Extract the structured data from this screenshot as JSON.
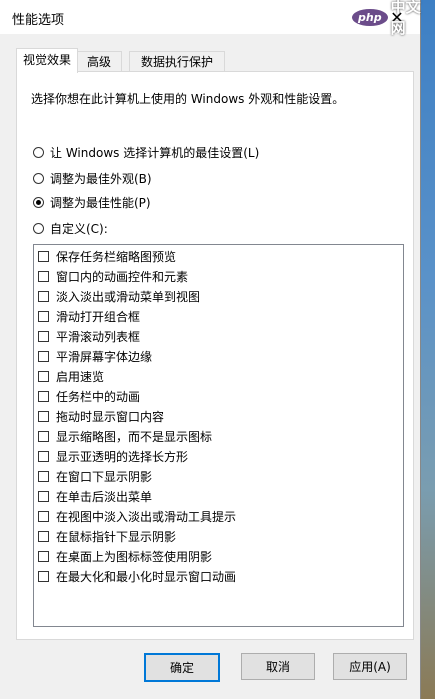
{
  "window": {
    "title": "性能选项",
    "close_glyph": "✕"
  },
  "watermark": {
    "logo": "php",
    "text": "中文网"
  },
  "tabs": [
    {
      "label": "视觉效果",
      "active": true
    },
    {
      "label": "高级",
      "active": false
    },
    {
      "label": "数据执行保护",
      "active": false
    }
  ],
  "description": "选择你想在此计算机上使用的 Windows 外观和性能设置。",
  "radio_options": [
    {
      "label": "让 Windows 选择计算机的最佳设置(L)",
      "selected": false
    },
    {
      "label": "调整为最佳外观(B)",
      "selected": false
    },
    {
      "label": "调整为最佳性能(P)",
      "selected": true
    },
    {
      "label": "自定义(C):",
      "selected": false
    }
  ],
  "checkbox_items": [
    {
      "label": "保存任务栏缩略图预览",
      "checked": false
    },
    {
      "label": "窗口内的动画控件和元素",
      "checked": false
    },
    {
      "label": "淡入淡出或滑动菜单到视图",
      "checked": false
    },
    {
      "label": "滑动打开组合框",
      "checked": false
    },
    {
      "label": "平滑滚动列表框",
      "checked": false
    },
    {
      "label": "平滑屏幕字体边缘",
      "checked": false
    },
    {
      "label": "启用速览",
      "checked": false
    },
    {
      "label": "任务栏中的动画",
      "checked": false
    },
    {
      "label": "拖动时显示窗口内容",
      "checked": false
    },
    {
      "label": "显示缩略图，而不是显示图标",
      "checked": false
    },
    {
      "label": "显示亚透明的选择长方形",
      "checked": false
    },
    {
      "label": "在窗口下显示阴影",
      "checked": false
    },
    {
      "label": "在单击后淡出菜单",
      "checked": false
    },
    {
      "label": "在视图中淡入淡出或滑动工具提示",
      "checked": false
    },
    {
      "label": "在鼠标指针下显示阴影",
      "checked": false
    },
    {
      "label": "在桌面上为图标标签使用阴影",
      "checked": false
    },
    {
      "label": "在最大化和最小化时显示窗口动画",
      "checked": false
    }
  ],
  "buttons": {
    "ok": "确定",
    "cancel": "取消",
    "apply": "应用(A)"
  },
  "colors": {
    "focus_border": "#0078d7",
    "dialog_bg": "#f0f0f0"
  }
}
